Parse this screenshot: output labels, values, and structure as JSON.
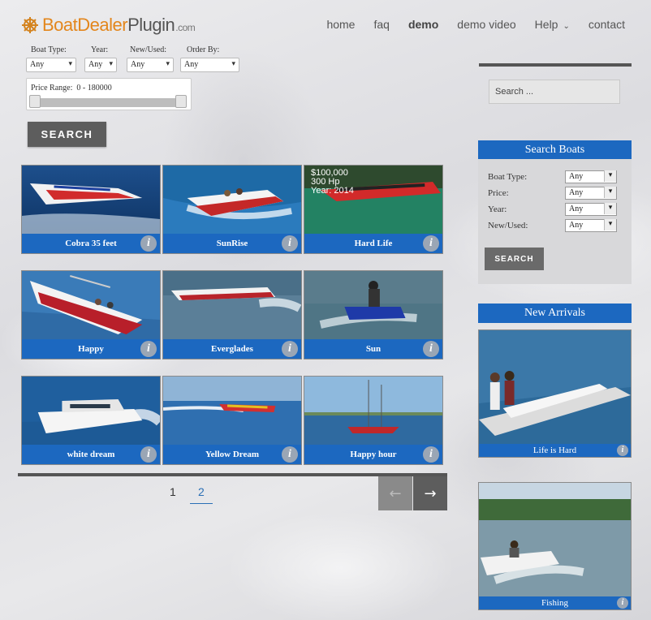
{
  "logo": {
    "part1": "Boat",
    "part2": "Dealer",
    "part3": "Plugin",
    "suffix": ".com",
    "icon": "ship-wheel-icon"
  },
  "nav": {
    "home": "home",
    "faq": "faq",
    "demo": "demo",
    "demo_video": "demo video",
    "help": "Help",
    "contact": "contact"
  },
  "filters": {
    "boat_type_label": "Boat Type:",
    "boat_type_value": "Any",
    "year_label": "Year:",
    "year_value": "Any",
    "new_used_label": "New/Used:",
    "new_used_value": "Any",
    "order_by_label": "Order By:",
    "order_by_value": "Any",
    "price_range_label": "Price Range:",
    "price_range_value": "0 - 180000",
    "search_label": "SEARCH"
  },
  "boats": [
    {
      "name": "Cobra 35 feet"
    },
    {
      "name": "SunRise"
    },
    {
      "name": "Hard Life",
      "price": "$100,000",
      "power": "300 Hp",
      "year": "Year: 2014"
    },
    {
      "name": "Happy"
    },
    {
      "name": "Everglades"
    },
    {
      "name": "Sun"
    },
    {
      "name": "white dream"
    },
    {
      "name": "Yellow Dream"
    },
    {
      "name": "Happy hour"
    }
  ],
  "pagination": {
    "page1": "1",
    "page2": "2",
    "prev": "←",
    "next": "→"
  },
  "sidebar": {
    "search_placeholder": "Search ...",
    "search_boats_title": "Search Boats",
    "boat_type_label": "Boat Type:",
    "boat_type_value": "Any",
    "price_label": "Price:",
    "price_value": "Any",
    "year_label": "Year:",
    "year_value": "Any",
    "new_used_label": "New/Used:",
    "new_used_value": "Any",
    "search_button": "SEARCH",
    "new_arrivals_title": "New Arrivals",
    "arrivals": [
      {
        "name": "Life is Hard"
      },
      {
        "name": "Fishing"
      }
    ]
  },
  "info_glyph": "i"
}
